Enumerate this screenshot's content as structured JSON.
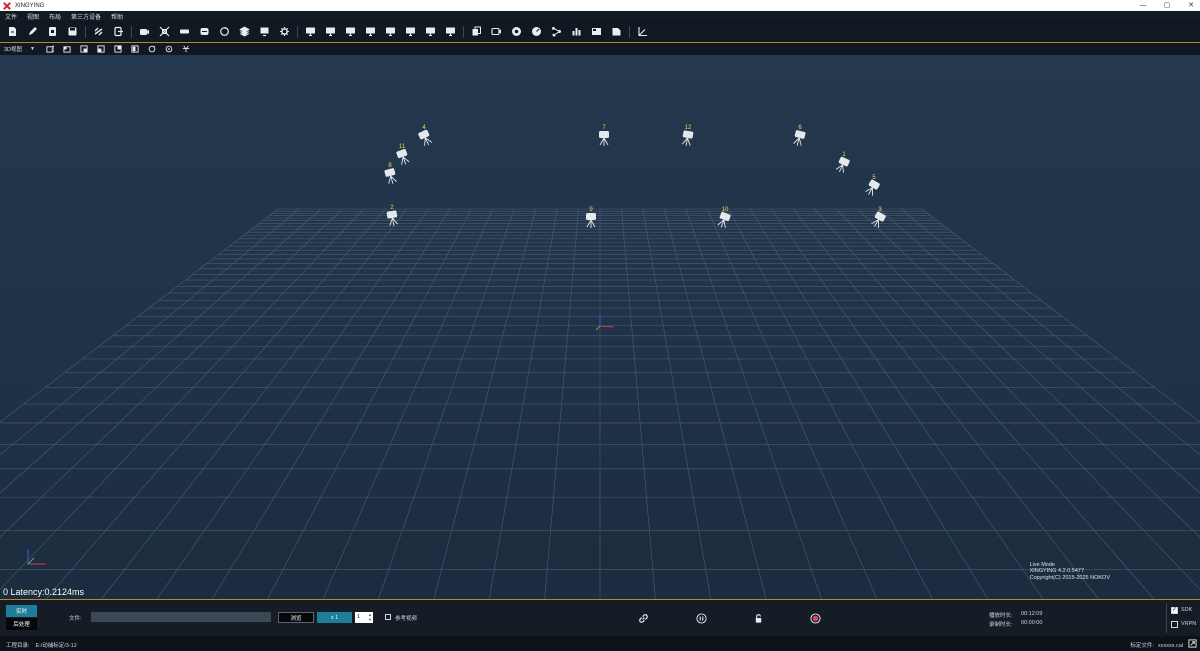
{
  "window": {
    "title": "XINGYING",
    "minimize_glyph": "—",
    "maximize_glyph": "▢",
    "close_glyph": "✕"
  },
  "menu": [
    "文件",
    "视图",
    "布局",
    "第三方设备",
    "帮助"
  ],
  "toolbar": {
    "groups": [
      [
        "new-file-icon",
        "edit-pen-icon",
        "open-file-icon",
        "save-icon"
      ],
      [
        "link-icon",
        "export-icon"
      ],
      [
        "camera-icon",
        "focus-icon",
        "strip-icon",
        "rig-icon",
        "refresh-icon",
        "layers-icon",
        "device-icon",
        "gear-icon"
      ],
      [
        "monitor-icon",
        "monitor-icon",
        "monitor-icon",
        "monitor-icon",
        "monitor-icon",
        "monitor-icon",
        "monitor-icon",
        "monitor-icon"
      ],
      [
        "copy-icon",
        "video-icon",
        "record-icon",
        "gauge-icon",
        "skeleton-icon",
        "bar-chart-icon",
        "panel-icon",
        "document-icon"
      ],
      [
        "axis-icon"
      ]
    ]
  },
  "viewbar": {
    "view_select": "3D视图",
    "buttons": [
      "perspective-icon",
      "front-view-icon",
      "side-view-icon",
      "top-view-icon",
      "back-view-icon",
      "bottom-view-icon",
      "rotate-icon",
      "marker-icon",
      "skeleton-view-icon"
    ]
  },
  "viewport": {
    "cameras": [
      {
        "id": "4"
      },
      {
        "id": "11"
      },
      {
        "id": "8"
      },
      {
        "id": "2"
      },
      {
        "id": "7"
      },
      {
        "id": "9"
      },
      {
        "id": "12"
      },
      {
        "id": "10"
      },
      {
        "id": "6"
      },
      {
        "id": "1"
      },
      {
        "id": "5"
      },
      {
        "id": "3"
      }
    ],
    "latency": "0 Latency:0.2124ms",
    "info": [
      "Live Mode",
      "XINGYING 4.2.0.5477",
      "Copyright(C) 2015-2025 NOKOV"
    ]
  },
  "controls": {
    "mode_live": "实时",
    "mode_post": "后处理",
    "file_label": "文件:",
    "file_value": "",
    "browse_label": "浏览",
    "speed_label": "x 1",
    "step_value": "1",
    "ref_video_label": "参考视频",
    "ref_video_checked": false,
    "play_time_label": "播放时长:",
    "play_time_value": "00:12:09",
    "record_time_label": "录制时长:",
    "record_time_value": "00:00:00",
    "sdk_label": "SDK",
    "sdk_checked": true,
    "vrpn_label": "VRPN",
    "vrpn_checked": false
  },
  "status": {
    "project_label": "工程目录:",
    "project_value": "E:/动捕标定/3-12",
    "calib_label": "标定文件:",
    "calib_value": "xxxxxx.cal"
  },
  "colors": {
    "accent": "#1d7d9a",
    "border_gold": "#b28a2e",
    "record_red": "#e0475b",
    "camera_label": "#d8e24a"
  }
}
